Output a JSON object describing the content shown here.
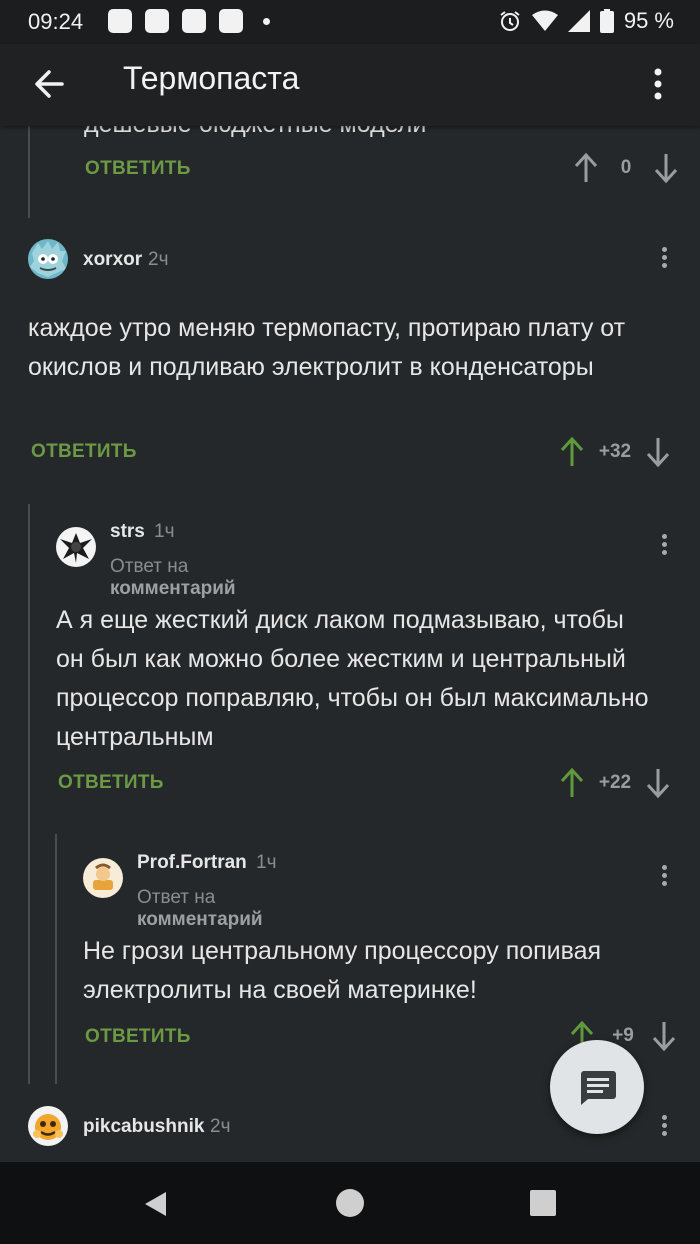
{
  "status_bar": {
    "time": "09:24",
    "battery_percent": "95 %"
  },
  "app_bar": {
    "title": "Термопаста"
  },
  "previous": {
    "cut_text": "дешевые бюджетные модели",
    "reply_label": "ОТВЕТИТЬ",
    "score": "0"
  },
  "comments": [
    {
      "author": "xorxor",
      "time": "2ч",
      "text": "каждое утро меняю термопасту, протираю плату от окислов и подливаю электролит в конденсаторы",
      "reply_label": "ОТВЕТИТЬ",
      "score": "+32"
    },
    {
      "author": "strs",
      "time": "1ч",
      "reply_prefix": "Ответ на",
      "reply_link": "комментарий",
      "text": "А я еще жесткий диск лаком подмазываю, чтобы он был как можно более жестким и центральный процессор поправляю, чтобы он был максимально центральным",
      "reply_label": "ОТВЕТИТЬ",
      "score": "+22"
    },
    {
      "author": "Prof.Fortran",
      "time": "1ч",
      "reply_prefix": "Ответ на",
      "reply_link": "комментарий",
      "text": "Не грози центральному процессору попивая электролиты на своей материнке!",
      "reply_label": "ОТВЕТИТЬ",
      "score": "+9"
    },
    {
      "author": "pikcabushnik",
      "time": "2ч"
    }
  ],
  "colors": {
    "background": "#25282a",
    "reply_green": "#6c9a44",
    "upvote_green": "#5f9a3c",
    "muted": "#8a8d90"
  }
}
